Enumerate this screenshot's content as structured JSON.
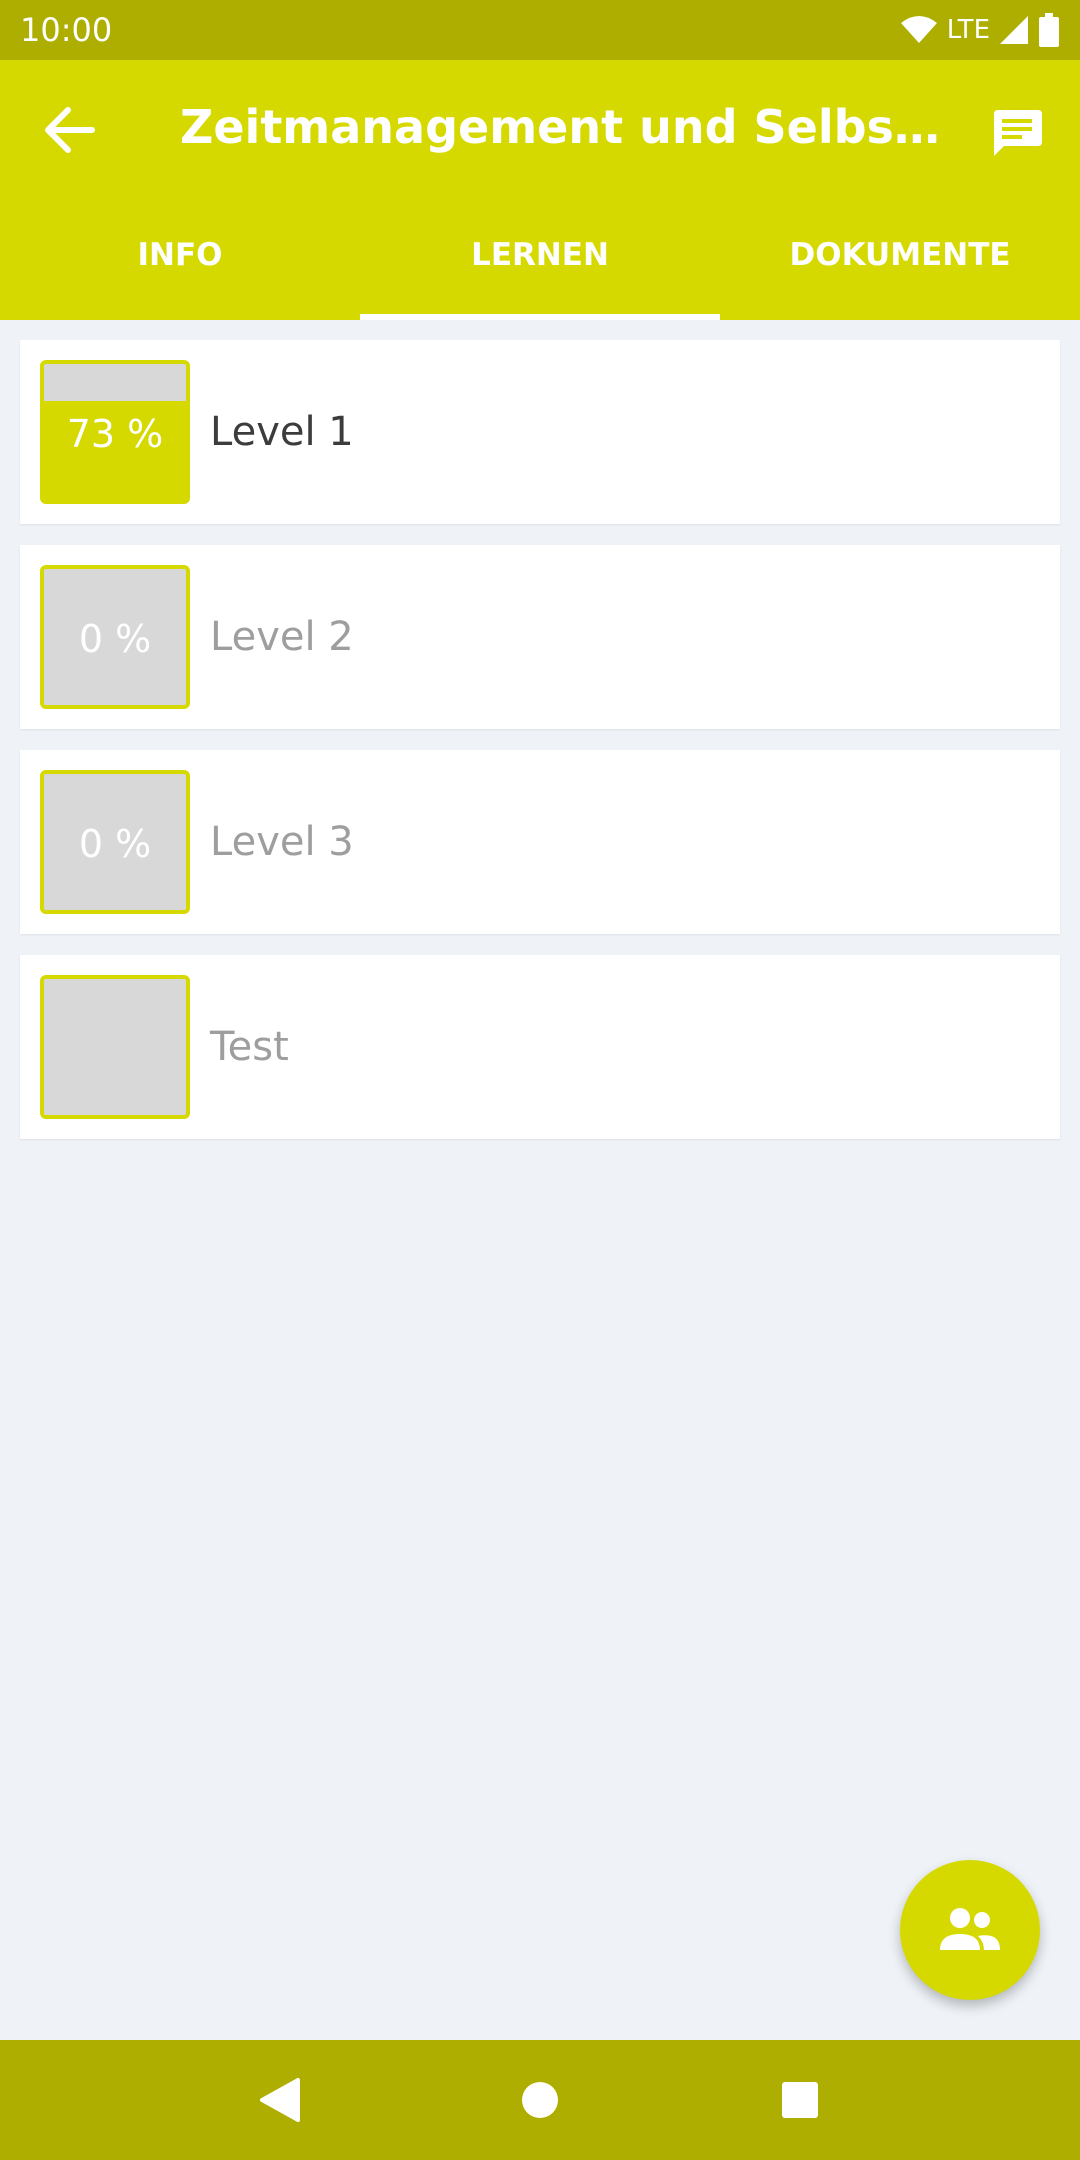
{
  "status_bar": {
    "time": "10:00",
    "network": "LTE"
  },
  "header": {
    "title": "Zeitmanagement und Selbstführung"
  },
  "tabs": [
    {
      "label": "INFO",
      "active": false
    },
    {
      "label": "LERNEN",
      "active": true
    },
    {
      "label": "DOKUMENTE",
      "active": false
    }
  ],
  "levels": [
    {
      "name": "Level 1",
      "progress_label": "73 %",
      "progress": 0.73,
      "locked": false
    },
    {
      "name": "Level 2",
      "progress_label": "0 %",
      "progress": 0,
      "locked": true
    },
    {
      "name": "Level 3",
      "progress_label": "0 %",
      "progress": 0,
      "locked": true
    },
    {
      "name": "Test",
      "progress_label": "",
      "progress": 0,
      "locked": true
    }
  ],
  "colors": {
    "accent": "#d6d900",
    "accent_dark": "#adae00",
    "background": "#eff3f7",
    "box_empty": "#d8d8d8"
  },
  "icons": {
    "back": "arrow-left-icon",
    "chat": "chat-icon",
    "fab": "group-icon",
    "nav_back": "triangle-back-icon",
    "nav_home": "circle-home-icon",
    "nav_recents": "square-recents-icon"
  }
}
